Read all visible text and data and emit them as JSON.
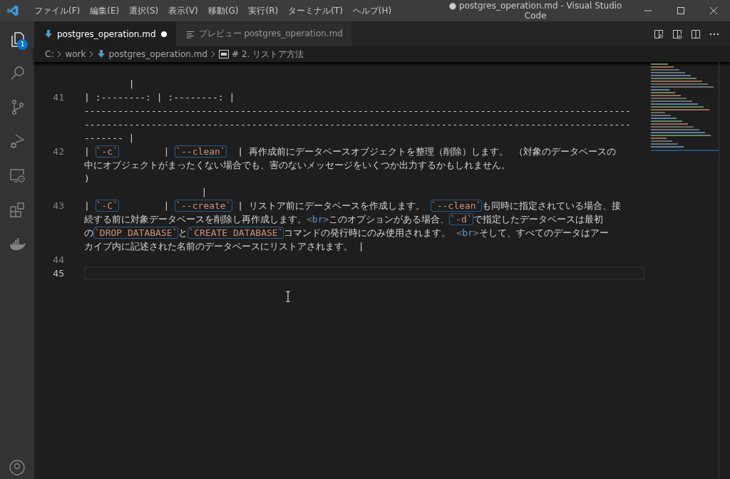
{
  "window": {
    "title": "● postgres_operation.md - Visual Studio Code"
  },
  "menu": [
    "ファイル(F)",
    "編集(E)",
    "選択(S)",
    "表示(V)",
    "移動(G)",
    "実行(R)",
    "ターミナル(T)",
    "ヘルプ(H)"
  ],
  "activity_bar": [
    {
      "kind": "explorer",
      "selected": true,
      "badge": "1"
    },
    {
      "kind": "search",
      "selected": false
    },
    {
      "kind": "source-control",
      "selected": false
    },
    {
      "kind": "debug",
      "selected": false
    },
    {
      "kind": "remote",
      "selected": false
    },
    {
      "kind": "extensions",
      "selected": false
    },
    {
      "kind": "docker",
      "selected": false
    },
    {
      "kind": "account",
      "selected": false
    }
  ],
  "tabs": [
    {
      "kind": "markdown",
      "label": "postgres_operation.md",
      "selected": true,
      "dirty": true
    },
    {
      "kind": "preview",
      "label": "プレビュー postgres_operation.md",
      "selected": false,
      "dirty": false
    }
  ],
  "breadcrumbs": [
    {
      "kind": "folder",
      "label": "C:"
    },
    {
      "kind": "folder",
      "label": "work"
    },
    {
      "kind": "markdown",
      "label": "postgres_operation.md"
    },
    {
      "kind": "heading",
      "label": "# 2. リストア方法"
    }
  ],
  "editor": {
    "rows": [
      {
        "segments": [
          {
            "kind": "text",
            "text": "        |"
          }
        ]
      },
      {
        "number": "41",
        "segments": [
          {
            "kind": "text",
            "text": "| :--------: | :--------: |"
          }
        ]
      },
      {
        "segments": [
          {
            "kind": "text",
            "text": "--------------------------------------------------------------------------------------------------"
          }
        ]
      },
      {
        "segments": [
          {
            "kind": "text",
            "text": "--------------------------------------------------------------------------------------------------"
          }
        ]
      },
      {
        "segments": [
          {
            "kind": "text",
            "text": "------- |"
          }
        ]
      },
      {
        "number": "42",
        "segments": [
          {
            "kind": "text",
            "text": "| "
          },
          {
            "kind": "code",
            "text": "`-c`"
          },
          {
            "kind": "text",
            "text": "        | "
          },
          {
            "kind": "code",
            "text": "`--clean`"
          },
          {
            "kind": "text",
            "text": "  | 再作成前にデータベースオブジェクトを整理（削除）します。 （対象のデータベースの"
          }
        ]
      },
      {
        "segments": [
          {
            "kind": "text",
            "text": "中にオブジェクトがまったくない場合でも、害のないメッセージをいくつか出力するかもしれません。"
          }
        ]
      },
      {
        "segments": [
          {
            "kind": "text",
            "text": ")"
          }
        ]
      },
      {
        "segments": [
          {
            "kind": "text",
            "text": "                     |"
          }
        ]
      },
      {
        "number": "43",
        "segments": [
          {
            "kind": "text",
            "text": "| "
          },
          {
            "kind": "code",
            "text": "`-C`"
          },
          {
            "kind": "text",
            "text": "        | "
          },
          {
            "kind": "code",
            "text": "`--create`"
          },
          {
            "kind": "text",
            "text": " | リストア前にデータベースを作成します。 "
          },
          {
            "kind": "code",
            "text": "`--clean`"
          },
          {
            "kind": "text",
            "text": "も同時に指定されている場合、接"
          }
        ]
      },
      {
        "segments": [
          {
            "kind": "text",
            "text": "続する前に対象データベースを削除し再作成します。"
          },
          {
            "kind": "punct",
            "text": "<"
          },
          {
            "kind": "tag",
            "text": "br"
          },
          {
            "kind": "punct",
            "text": ">"
          },
          {
            "kind": "text",
            "text": "このオプションがある場合、"
          },
          {
            "kind": "code",
            "text": "`-d`"
          },
          {
            "kind": "text",
            "text": "で指定したデータベースは最初"
          }
        ]
      },
      {
        "segments": [
          {
            "kind": "text",
            "text": "の"
          },
          {
            "kind": "code",
            "text": "`DROP DATABASE`"
          },
          {
            "kind": "text",
            "text": "と"
          },
          {
            "kind": "code",
            "text": "`CREATE DATABASE`"
          },
          {
            "kind": "text",
            "text": "コマンドの発行時にのみ使用されます。 "
          },
          {
            "kind": "punct",
            "text": "<"
          },
          {
            "kind": "tag",
            "text": "br"
          },
          {
            "kind": "punct",
            "text": ">"
          },
          {
            "kind": "text",
            "text": "そして、すべてのデータはアー"
          }
        ]
      },
      {
        "segments": [
          {
            "kind": "text",
            "text": "カイブ内に記述された名前のデータベースにリストアされます。 |"
          }
        ]
      },
      {
        "number": "44",
        "segments": []
      },
      {
        "number": "45",
        "current": true,
        "segments": []
      }
    ]
  }
}
